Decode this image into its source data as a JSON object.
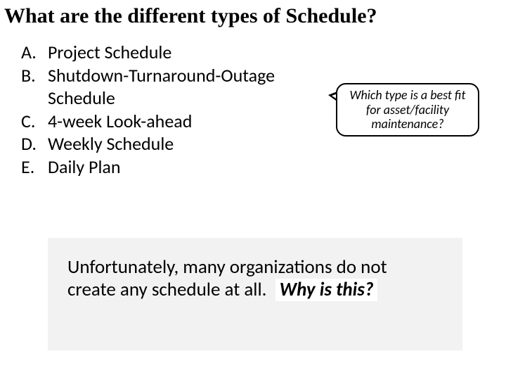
{
  "title": "What are the different types of Schedule?",
  "list": {
    "items": [
      {
        "marker": "A.",
        "text": "Project Schedule"
      },
      {
        "marker": "B.",
        "text": "Shutdown-Turnaround-Outage Schedule"
      },
      {
        "marker": "C.",
        "text": "4-week Look-ahead"
      },
      {
        "marker": "D.",
        "text": "Weekly Schedule"
      },
      {
        "marker": "E.",
        "text": "Daily Plan"
      }
    ]
  },
  "callout": {
    "text": "Which type is a best fit for asset/facility maintenance?"
  },
  "bottom": {
    "line1": "Unfortunately, many organizations do not",
    "line2_prefix": "create any schedule at all.",
    "question": "Why is this?"
  }
}
